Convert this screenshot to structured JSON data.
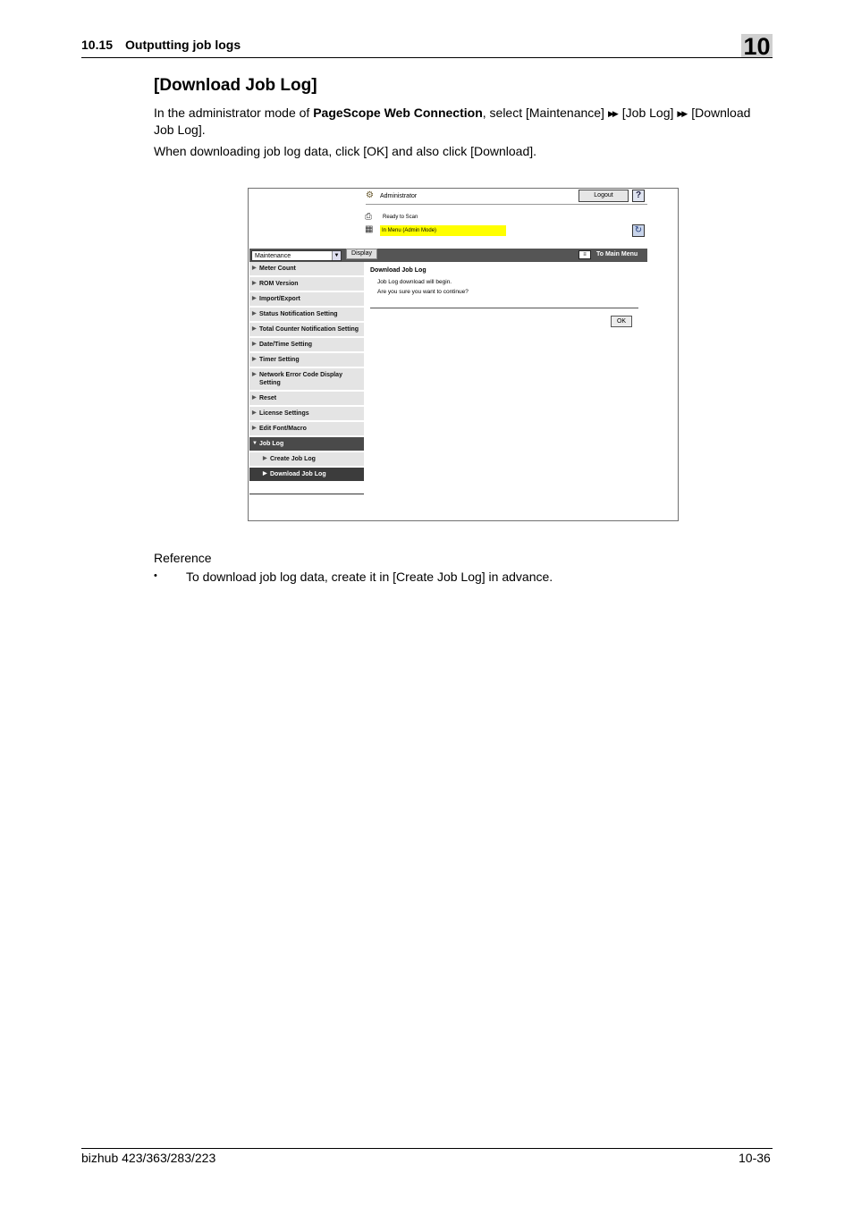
{
  "header": {
    "section": "10.15 Outputting job logs",
    "chapter": "10"
  },
  "title": "[Download Job Log]",
  "intro": {
    "p1_pre": "In the administrator mode of ",
    "p1_bold": "PageScope Web Connection",
    "p1_post1": ", select [Maintenance]",
    "p1_mid": "[Job Log]",
    "p1_post2": "[Download Job Log].",
    "arrow_glyph": "▶▶",
    "p2": "When downloading job log data, click [OK] and also click [Download]."
  },
  "screenshot": {
    "admin_label": "Administrator",
    "logout_label": "Logout",
    "help_label": "?",
    "status_ready": "Ready to Scan",
    "status_mode": "In Menu (Admin Mode)",
    "refresh_icon": "↻",
    "menu_select_value": "Maintenance",
    "display_label": "Display",
    "main_menu_label": "To Main Menu",
    "sidebar": [
      {
        "label": "Meter Count"
      },
      {
        "label": "ROM Version"
      },
      {
        "label": "Import/Export"
      },
      {
        "label": "Status Notification Setting"
      },
      {
        "label": "Total Counter Notification Setting"
      },
      {
        "label": "Date/Time Setting"
      },
      {
        "label": "Timer Setting"
      },
      {
        "label": "Network Error Code Display Setting"
      },
      {
        "label": "Reset"
      },
      {
        "label": "License Settings"
      },
      {
        "label": "Edit Font/Macro"
      },
      {
        "label": "Job Log"
      },
      {
        "label": "Create Job Log"
      },
      {
        "label": "Download Job Log"
      }
    ],
    "content_title": "Download Job Log",
    "content_msg1": "Job Log download will begin.",
    "content_msg2": "Are you sure you want to continue?",
    "ok_label": "OK"
  },
  "reference": {
    "label": "Reference",
    "bullet": "•",
    "item": "To download job log data, create it in [Create Job Log] in advance."
  },
  "footer": {
    "model": "bizhub 423/363/283/223",
    "page": "10-36"
  }
}
